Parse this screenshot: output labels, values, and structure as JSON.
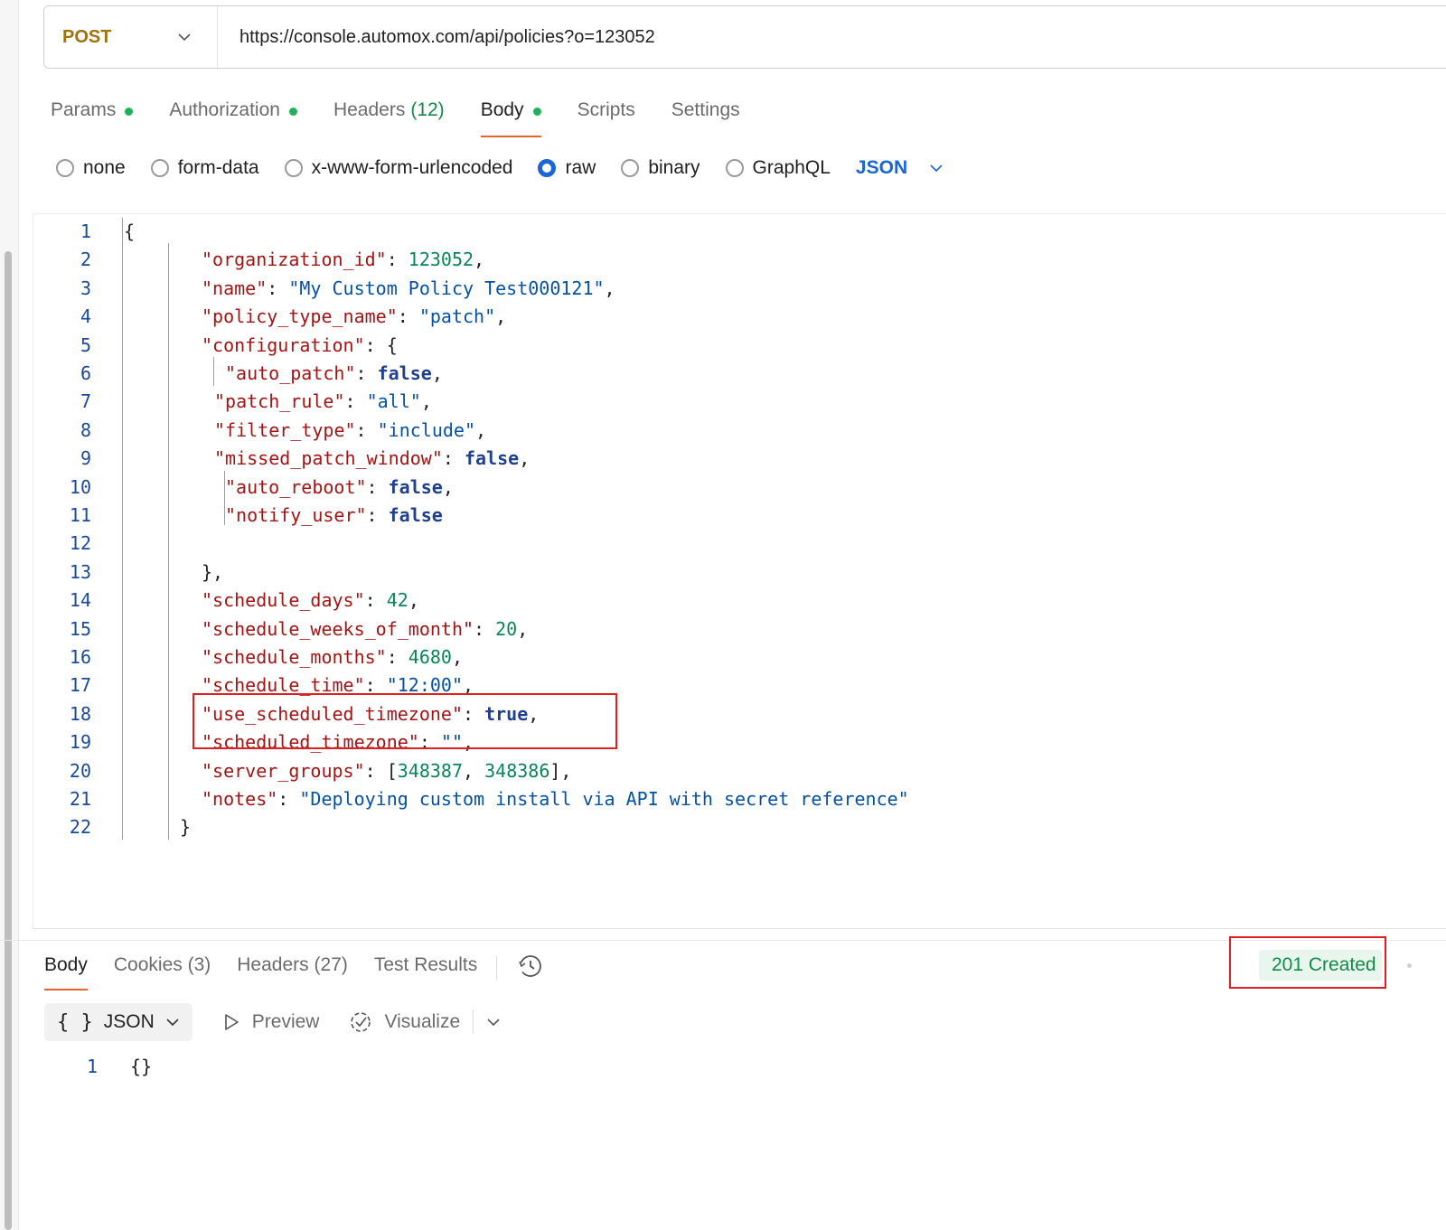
{
  "request": {
    "method": "POST",
    "url": "https://console.automox.com/api/policies?o=123052"
  },
  "request_tabs": [
    {
      "label": "Params",
      "dot": true
    },
    {
      "label": "Authorization",
      "dot": true
    },
    {
      "label": "Headers",
      "count": "(12)"
    },
    {
      "label": "Body",
      "dot": true,
      "active": true
    },
    {
      "label": "Scripts"
    },
    {
      "label": "Settings"
    }
  ],
  "body_types": [
    "none",
    "form-data",
    "x-www-form-urlencoded",
    "raw",
    "binary",
    "GraphQL"
  ],
  "body_selected": "raw",
  "body_format": "JSON",
  "code_lines": [
    {
      "n": "1",
      "text": "{"
    },
    {
      "n": "2",
      "text": "\"organization_id\": 123052,"
    },
    {
      "n": "3",
      "text": "\"name\": \"My Custom Policy Test000121\","
    },
    {
      "n": "4",
      "text": "\"policy_type_name\": \"patch\","
    },
    {
      "n": "5",
      "text": "\"configuration\": {"
    },
    {
      "n": "6",
      "text": "\"auto_patch\": false,"
    },
    {
      "n": "7",
      "text": "\"patch_rule\": \"all\","
    },
    {
      "n": "8",
      "text": "\"filter_type\": \"include\","
    },
    {
      "n": "9",
      "text": "\"missed_patch_window\": false,"
    },
    {
      "n": "10",
      "text": "\"auto_reboot\": false,"
    },
    {
      "n": "11",
      "text": "\"notify_user\": false"
    },
    {
      "n": "12",
      "text": ""
    },
    {
      "n": "13",
      "text": "},"
    },
    {
      "n": "14",
      "text": "\"schedule_days\": 42,"
    },
    {
      "n": "15",
      "text": "\"schedule_weeks_of_month\": 20,"
    },
    {
      "n": "16",
      "text": "\"schedule_months\": 4680,"
    },
    {
      "n": "17",
      "text": "\"schedule_time\": \"12:00\","
    },
    {
      "n": "18",
      "text": "\"use_scheduled_timezone\": true,"
    },
    {
      "n": "19",
      "text": "\"scheduled_timezone\": \"\","
    },
    {
      "n": "20",
      "text": "\"server_groups\": [348387, 348386],"
    },
    {
      "n": "21",
      "text": "\"notes\": \"Deploying custom install via API with secret reference\""
    },
    {
      "n": "22",
      "text": "}"
    }
  ],
  "response_tabs": [
    {
      "label": "Body",
      "active": true
    },
    {
      "label": "Cookies",
      "count": "(3)"
    },
    {
      "label": "Headers",
      "count": "(27)"
    },
    {
      "label": "Test Results"
    }
  ],
  "response_status": "201 Created",
  "response_toolbar": {
    "format_braces": "{ }",
    "format": "JSON",
    "preview": "Preview",
    "visualize": "Visualize"
  },
  "response_lines": [
    {
      "n": "1",
      "text": "{}"
    }
  ],
  "colors": {
    "accent": "#e8632b",
    "method": "#a0720c",
    "status_green": "#138a4a",
    "highlight_red": "#e02020",
    "link_blue": "#1a66d2"
  }
}
